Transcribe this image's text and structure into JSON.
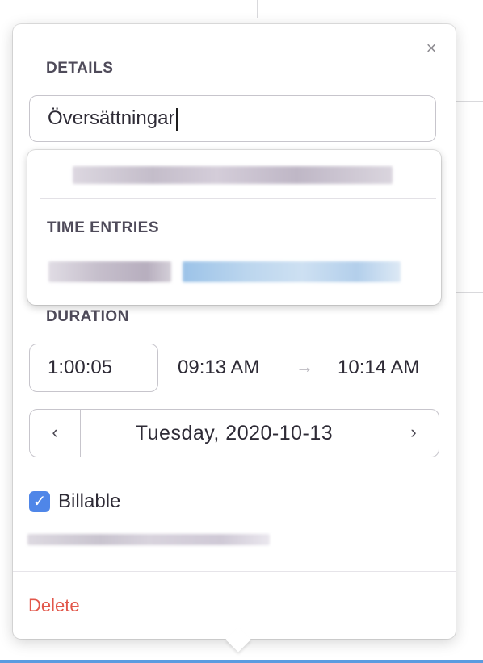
{
  "details": {
    "section_label": "DETAILS",
    "description_value": "Översättningar",
    "close_icon": "close-icon"
  },
  "autocomplete": {
    "time_entries_label": "TIME ENTRIES"
  },
  "duration": {
    "section_label": "DURATION",
    "value": "1:00:05",
    "start_time": "09:13 AM",
    "end_time": "10:14 AM",
    "arrow": "→"
  },
  "date_picker": {
    "prev": "‹",
    "next": "›",
    "date": "Tuesday, 2020-10-13"
  },
  "billable": {
    "checked": true,
    "check_glyph": "✓",
    "label": "Billable"
  },
  "footer": {
    "delete_label": "Delete"
  },
  "colors": {
    "accent_blue": "#4f86e8",
    "delete_red": "#e2574a"
  }
}
